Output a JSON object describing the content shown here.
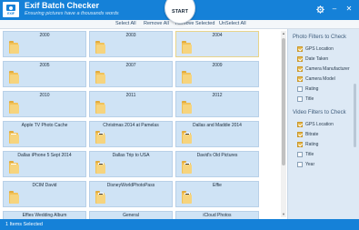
{
  "app": {
    "title": "Exif Batch Checker",
    "subtitle": "Ensuring pictures have a thousands words",
    "logo_text": "EXIF",
    "start_label": "START",
    "settings_icon": "gear-icon",
    "minimize_symbol": "–",
    "close_symbol": "✕",
    "accent_color": "#1581d8"
  },
  "toolbar": {
    "select_all": "Select All",
    "remove_all": "Remove All",
    "remove_selected": "Remove Selected",
    "unselect_all": "UnSelect All"
  },
  "folders": [
    {
      "label": "2000",
      "kind": "folder"
    },
    {
      "label": "2003",
      "kind": "folder"
    },
    {
      "label": "2004",
      "kind": "folder",
      "selected": true
    },
    {
      "label": "2005",
      "kind": "folder"
    },
    {
      "label": "2007",
      "kind": "folder"
    },
    {
      "label": "2009",
      "kind": "folder"
    },
    {
      "label": "2010",
      "kind": "folder"
    },
    {
      "label": "2011",
      "kind": "folder"
    },
    {
      "label": "2012",
      "kind": "folder"
    },
    {
      "label": "Apple TV Photo Cache",
      "kind": "paper"
    },
    {
      "label": "Christmas 2014 at Pamelas",
      "kind": "photo"
    },
    {
      "label": "Dallas and Maddie 2014",
      "kind": "photo"
    },
    {
      "label": "Dallas iPhone 5 Sept 2014",
      "kind": "paper"
    },
    {
      "label": "Dallas Trip to USA",
      "kind": "photo"
    },
    {
      "label": "David's Old Pictures",
      "kind": "photo"
    },
    {
      "label": "DCIM David",
      "kind": "folder"
    },
    {
      "label": "DisneyWorldPhotoPass",
      "kind": "photo"
    },
    {
      "label": "Effie",
      "kind": "photo"
    },
    {
      "label": "Effies Wedding Album",
      "kind": "folder"
    },
    {
      "label": "General",
      "kind": "folder"
    },
    {
      "label": "iCloud Photos",
      "kind": "folder"
    }
  ],
  "photo_filters": {
    "heading": "Photo Filters to Check",
    "items": [
      {
        "label": "GPS Location",
        "checked": true
      },
      {
        "label": "Date Taken",
        "checked": true
      },
      {
        "label": "Camera Manufacturer",
        "checked": true
      },
      {
        "label": "Camera Model",
        "checked": true
      },
      {
        "label": "Rating",
        "checked": false
      },
      {
        "label": "Title",
        "checked": false
      }
    ]
  },
  "video_filters": {
    "heading": "Video Filters to Check",
    "items": [
      {
        "label": "GPS Location",
        "checked": true
      },
      {
        "label": "Bitrate",
        "checked": true
      },
      {
        "label": "Rating",
        "checked": true
      },
      {
        "label": "Title",
        "checked": false
      },
      {
        "label": "Year",
        "checked": false
      }
    ]
  },
  "status": {
    "text": "1 Items Selected"
  }
}
